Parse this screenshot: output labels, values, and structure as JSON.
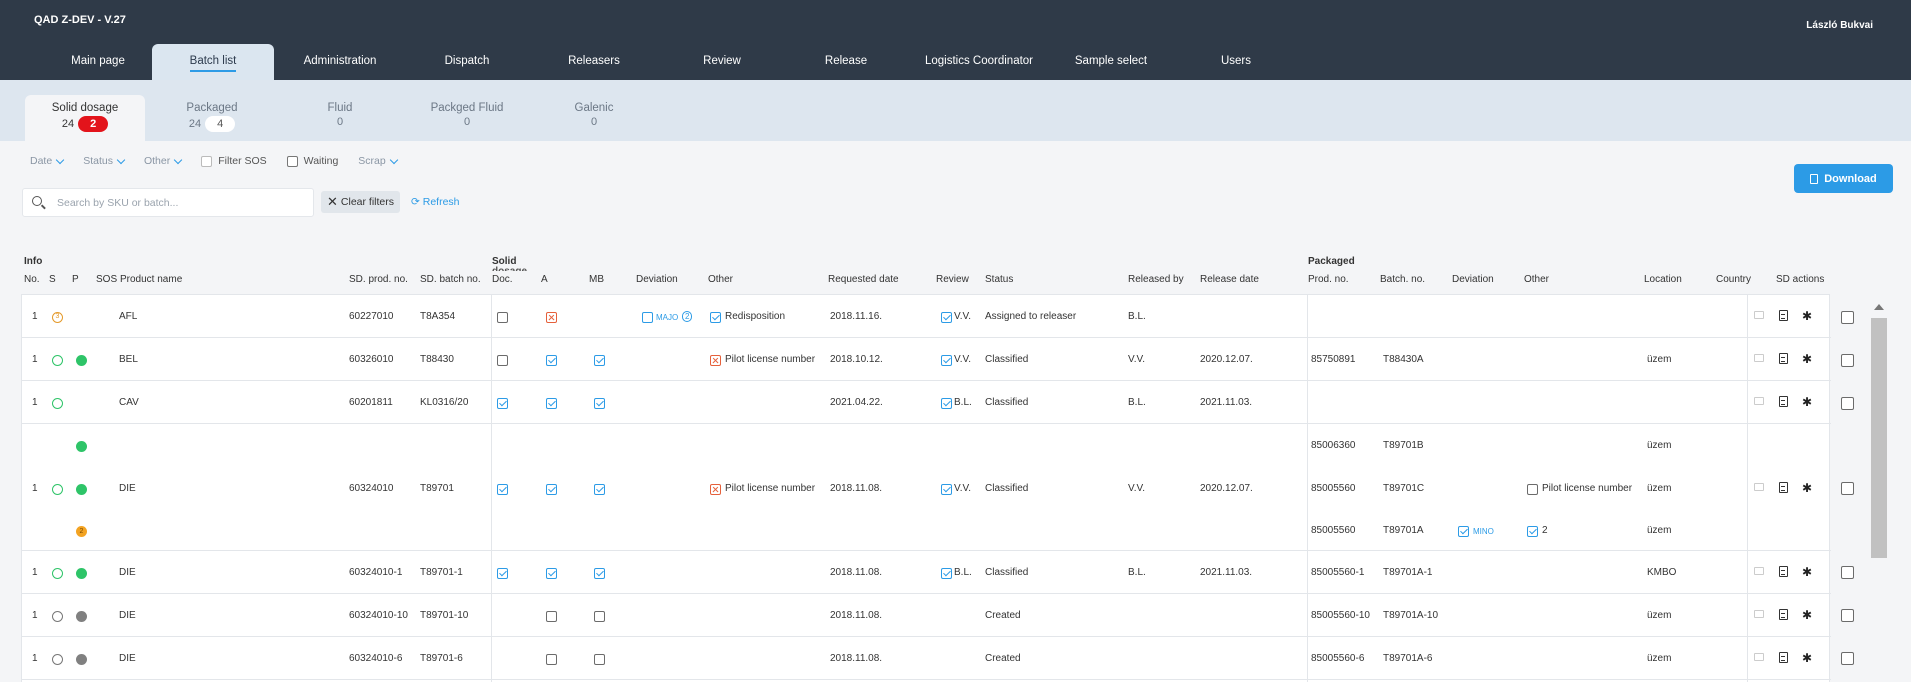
{
  "app": {
    "title": "QAD Z-DEV - V.27",
    "user": "László Bukvai"
  },
  "nav": [
    {
      "label": "Main page"
    },
    {
      "label": "Batch list"
    },
    {
      "label": "Administration"
    },
    {
      "label": "Dispatch"
    },
    {
      "label": "Releasers"
    },
    {
      "label": "Review"
    },
    {
      "label": "Release"
    },
    {
      "label": "Logistics Coordinator"
    },
    {
      "label": "Sample select"
    },
    {
      "label": "Users"
    }
  ],
  "categories": [
    {
      "name": "Solid dosage",
      "count": "24",
      "badge": "2"
    },
    {
      "name": "Packaged",
      "count": "24",
      "badge": "4"
    },
    {
      "name": "Fluid",
      "count": "0"
    },
    {
      "name": "Packged Fluid",
      "count": "0"
    },
    {
      "name": "Galenic",
      "count": "0"
    }
  ],
  "filters": {
    "date": "Date",
    "status": "Status",
    "other": "Other",
    "filter_sos": "Filter SOS",
    "waiting": "Waiting",
    "scrap": "Scrap"
  },
  "search": {
    "placeholder": "Search by SKU or batch..."
  },
  "buttons": {
    "clear": "Clear filters",
    "refresh": "Refresh",
    "download": "Download"
  },
  "table": {
    "groups": {
      "info": "Info",
      "solid": "Solid",
      "solid_sub": "dosage",
      "packaged": "Packaged"
    },
    "headers": {
      "no": "No.",
      "s": "S",
      "p": "P",
      "sos": "SOS",
      "product": "Product name",
      "sd_prod": "SD. prod. no.",
      "sd_batch": "SD. batch no.",
      "doc": "Doc.",
      "a": "A",
      "mb": "MB",
      "deviation": "Deviation",
      "other": "Other",
      "requested": "Requested date",
      "review": "Review",
      "status": "Status",
      "released_by": "Released by",
      "release_date": "Release date",
      "prod_no": "Prod. no.",
      "batch_no": "Batch. no.",
      "p_deviation": "Deviation",
      "p_other": "Other",
      "location": "Location",
      "country": "Country",
      "sd_actions": "SD actions"
    },
    "rows": [
      {
        "no": "1",
        "sos_num": "3",
        "product": "AFL",
        "sd_prod": "60227010",
        "sd_batch": "T8A354",
        "deviation": "MAJO",
        "deviation_count": "2",
        "other": "Redisposition",
        "requested": "2018.11.16.",
        "review": "V.V.",
        "status": "Assigned to releaser",
        "released_by": "B.L.",
        "release_date": ""
      },
      {
        "no": "1",
        "product": "BEL",
        "sd_prod": "60326010",
        "sd_batch": "T88430",
        "other": "Pilot license number",
        "requested": "2018.10.12.",
        "review": "V.V.",
        "status": "Classified",
        "released_by": "V.V.",
        "release_date": "2020.12.07.",
        "prod_no": "85750891",
        "batch_no": "T88430A",
        "location": "üzem"
      },
      {
        "no": "1",
        "product": "CAV",
        "sd_prod": "60201811",
        "sd_batch": "KL0316/20",
        "requested": "2021.04.22.",
        "review": "B.L.",
        "status": "Classified",
        "released_by": "B.L.",
        "release_date": "2021.11.03."
      },
      {
        "no": "1",
        "product": "DIE",
        "sd_prod": "60324010",
        "sd_batch": "T89701",
        "other": "Pilot license number",
        "requested": "2018.11.08.",
        "review": "V.V.",
        "status": "Classified",
        "released_by": "V.V.",
        "release_date": "2020.12.07.",
        "sos_num": "2",
        "packaged": [
          {
            "prod_no": "85006360",
            "batch_no": "T89701B",
            "location": "üzem"
          },
          {
            "prod_no": "85005560",
            "batch_no": "T89701C",
            "other": "Pilot license number",
            "location": "üzem"
          },
          {
            "prod_no": "85005560",
            "batch_no": "T89701A",
            "deviation": "MINO",
            "other": "2",
            "location": "üzem"
          }
        ]
      },
      {
        "no": "1",
        "product": "DIE",
        "sd_prod": "60324010-1",
        "sd_batch": "T89701-1",
        "requested": "2018.11.08.",
        "review": "B.L.",
        "status": "Classified",
        "released_by": "B.L.",
        "release_date": "2021.11.03.",
        "prod_no": "85005560-1",
        "batch_no": "T89701A-1",
        "location": "KMBO"
      },
      {
        "no": "1",
        "product": "DIE",
        "sd_prod": "60324010-10",
        "sd_batch": "T89701-10",
        "requested": "2018.11.08.",
        "status": "Created",
        "prod_no": "85005560-10",
        "batch_no": "T89701A-10",
        "location": "üzem"
      },
      {
        "no": "1",
        "product": "DIE",
        "sd_prod": "60324010-6",
        "sd_batch": "T89701-6",
        "requested": "2018.11.08.",
        "status": "Created",
        "prod_no": "85005560-6",
        "batch_no": "T89701A-6",
        "location": "üzem"
      }
    ]
  },
  "colors": {
    "header": "#2f3a48",
    "accent": "#2c9be6",
    "badge_red": "#e3141b",
    "status_green": "#2ec468"
  }
}
